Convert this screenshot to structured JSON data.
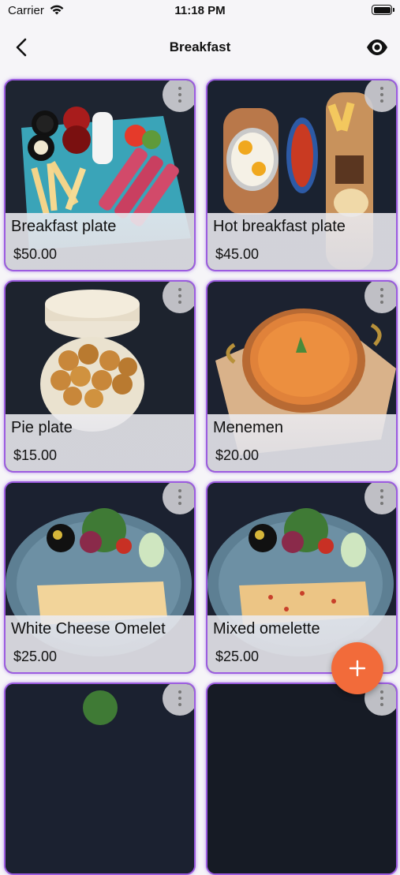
{
  "status_bar": {
    "carrier": "Carrier",
    "time": "11:18 PM"
  },
  "navbar": {
    "title": "Breakfast",
    "back_icon": "chevron-left-icon",
    "view_icon": "eye-icon"
  },
  "products": [
    {
      "name": "Breakfast plate",
      "price": "$50.00"
    },
    {
      "name": "Hot breakfast plate",
      "price": "$45.00"
    },
    {
      "name": "Pie plate",
      "price": "$15.00"
    },
    {
      "name": "Menemen",
      "price": "$20.00"
    },
    {
      "name": "White Cheese Omelet",
      "price": "$25.00"
    },
    {
      "name": "Mixed omelette",
      "price": "$25.00"
    },
    {
      "name": "",
      "price": ""
    },
    {
      "name": "",
      "price": ""
    }
  ],
  "fab": {
    "icon": "plus-icon"
  },
  "colors": {
    "accent_border": "#9c5ce0",
    "fab": "#f26b3a"
  }
}
